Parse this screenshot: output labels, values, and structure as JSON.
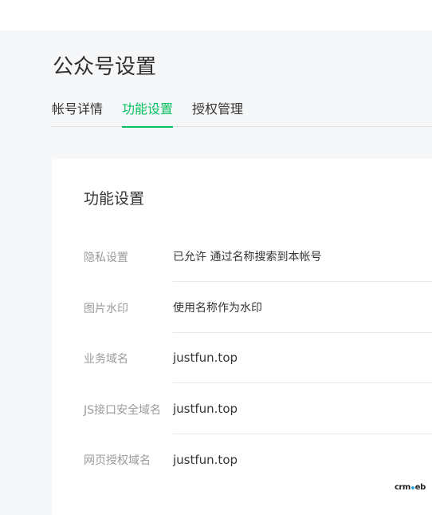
{
  "page": {
    "title": "公众号设置"
  },
  "tabs": [
    {
      "label": "帐号详情",
      "active": false
    },
    {
      "label": "功能设置",
      "active": true
    },
    {
      "label": "授权管理",
      "active": false
    }
  ],
  "section": {
    "title": "功能设置",
    "rows": [
      {
        "label": "隐私设置",
        "value": "已允许 通过名称搜索到本帐号"
      },
      {
        "label": "图片水印",
        "value": "使用名称作为水印"
      },
      {
        "label": "业务域名",
        "value": "justfun.top"
      },
      {
        "label": "JS接口安全域名",
        "value": "justfun.top"
      },
      {
        "label": "网页授权域名",
        "value": "justfun.top"
      }
    ]
  },
  "watermark": {
    "left": "crm",
    "right": "eb"
  },
  "colors": {
    "accent": "#07c160",
    "background": "#f6f7f9",
    "card": "#ffffff",
    "label": "#9a9a9a",
    "text": "#353535"
  }
}
